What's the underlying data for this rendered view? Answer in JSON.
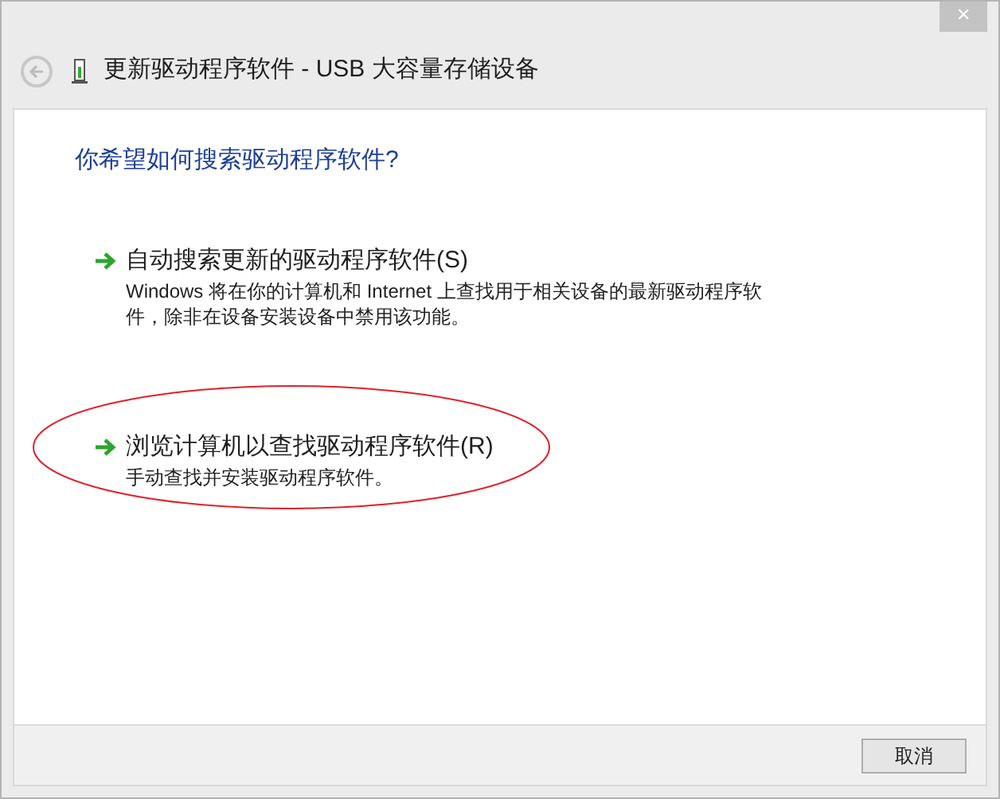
{
  "window": {
    "title": "更新驱动程序软件 - USB 大容量存储设备",
    "close": "✕"
  },
  "question": "你希望如何搜索驱动程序软件?",
  "options": [
    {
      "title": "自动搜索更新的驱动程序软件(S)",
      "description": "Windows 将在你的计算机和 Internet 上查找用于相关设备的最新驱动程序软件，除非在设备安装设备中禁用该功能。",
      "circled": false
    },
    {
      "title": "浏览计算机以查找驱动程序软件(R)",
      "description": "手动查找并安装驱动程序软件。",
      "circled": true
    }
  ],
  "buttons": [
    "取消"
  ]
}
